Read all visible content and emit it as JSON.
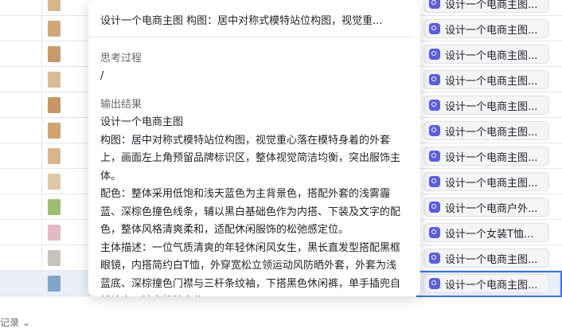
{
  "popup": {
    "title": "设计一个电商主图 构图：居中对称式模特站位构图，视觉重...",
    "thinking_label": "思考过程",
    "thinking_value": "/",
    "output_label": "输出结果",
    "output_text": "设计一个电商主图\n构图：居中对称式模特站位构图，视觉重心落在模特身着的外套上，画面左上角预留品牌标识区，整体视觉简洁均衡，突出服饰主体。\n配色：整体采用低饱和浅天蓝色为主背景色，搭配外套的浅雾霾蓝、深棕色撞色线条，辅以黑白基础色作为内搭、下装及文字的配色，整体风格清爽柔和，适配休闲服饰的松弛感定位。\n主体描述：一位气质清爽的年轻休闲风女生，黑长直发型搭配黑框眼镜，内搭简约白T恤，外穿宽松立领运动风防晒外套，外套为浅蓝底、深棕撞色门襟与三杆条纹袖，下搭黑色休闲裤，单手插兜自然站立，神态松弛自信。"
  },
  "chips": [
    "设计一个电商主图...",
    "设计一个电商主图...",
    "设计一个电商主图...",
    "设计一个电商主图...",
    "设计一个电商主图...",
    "设计一个电商主图...",
    "设计一个电商主图...",
    "设计一个电商主图...",
    "设计一个电商户外...",
    "设计一个女装T恤...",
    "设计一个电商主图...",
    "设计一个电商主图..."
  ],
  "thumb_colors": [
    "#d9b58a",
    "#cfa77a",
    "#c89a6a",
    "#d8bd93",
    "#c8965e",
    "#d1a36d",
    "#d9b58a",
    "#e2c9a6",
    "#9bbf6e",
    "#e6b8c4",
    "#c9c1bd",
    "#7ea6c9"
  ],
  "footer": {
    "label": "记录 ⌄"
  },
  "colors": {
    "accent": "#3370ff",
    "chip_icon": "#5b5ce6"
  }
}
